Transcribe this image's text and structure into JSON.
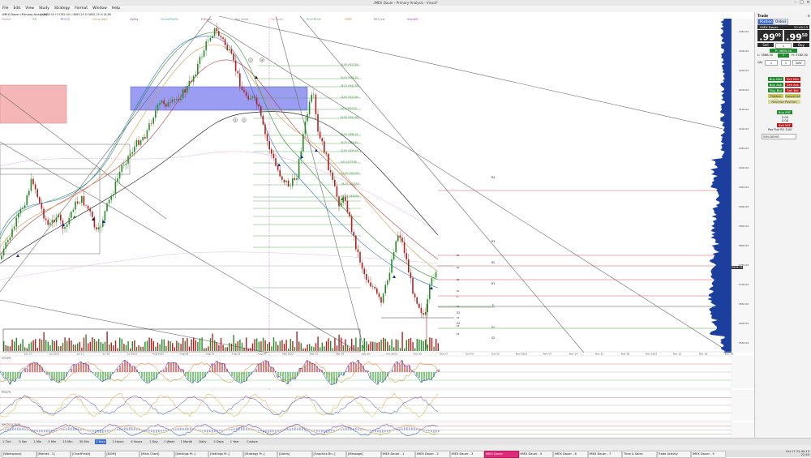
{
  "window": {
    "title": ".IMEX Dauer - Primary Analysis - Visual*",
    "controls": [
      "–",
      "□",
      "✕"
    ]
  },
  "menu": [
    "File",
    "Edit",
    "View",
    "Study",
    "Strategy",
    "Format",
    "Window",
    "Help"
  ],
  "chart": {
    "symbol_header": ".IMEX Dauer (Primary Analysis)",
    "ohlc_text": "L:3588.50 H:3782.00 L:3685.25 D:3695.25 V:14.88",
    "study_labels": [
      "Volume",
      "RSI",
      "MFI(14)",
      "Swing Highs",
      "ZigZag",
      "Volume Profile",
      "Bollinger",
      "Key Levels",
      "Fib Levels",
      "Pivot Points",
      "VWAP",
      "MA Cross",
      "Highlight"
    ],
    "x_dates": [
      "Jun 27",
      "Jul 2022",
      "Jul 11",
      "Jul 18",
      "Jul 2022",
      "Aug 2022",
      "Aug 08",
      "Aug 15",
      "Aug 22",
      "Aug 29",
      "Sep 2022",
      "Sep 12",
      "Sep 19",
      "Sep 26",
      "Oct 2022",
      "Oct 10",
      "Oct 17",
      "Oct 24",
      "Oct 31",
      "Nov 2022",
      "Nov 07",
      "Nov 14",
      "Nov 21",
      "Nov 28",
      "Dec 2022",
      "Dec 12",
      "Dec 19",
      "Dec 26"
    ],
    "right_prices": [
      "4350.00",
      "4300.00",
      "4250.00",
      "4200.00",
      "4150.00",
      "4100.00",
      "4050.00",
      "4000.00",
      "3950.00",
      "3900.00",
      "3850.00",
      "3800.00",
      "3750.00",
      "3700.00",
      "3650.00",
      "3600.00",
      "3550.00"
    ],
    "current_price": "3695.25",
    "pivot_labels": [
      "R4",
      "R3",
      "R2",
      "R1",
      "P",
      "S1",
      "S2",
      "S3",
      "S4"
    ],
    "wave_labels": [
      "2",
      "4",
      "3",
      "1"
    ],
    "fib_labels": [
      "61.8% (4317.89)",
      "50.0% (4195.25)",
      "38.2% (4162.78)",
      "23.6% (4123.38)",
      "0.0% (4053.25)",
      "61.8% (3932.38)",
      "50.0% (3896.10)",
      "38.2% (3859.81)",
      "23.6% (3814.93)",
      "0.0% (3774.00)",
      "-23.6% (3702.94)",
      "-38.2% (3659.00)",
      "-61.8% (3588.06)"
    ],
    "indicator_titles": [
      "CCI(14)",
      "RSI(14)",
      "MACD(12,26,9)"
    ]
  },
  "tradepanel": {
    "title": "Trade",
    "tabs": [
      "Position",
      "Orders"
    ],
    "symbol": ".IMEX Dauer",
    "time": "22:40:13",
    "bid_big": ".99",
    "bid_sup": "00",
    "ask_big": ".99",
    "ask_sup": "50",
    "sell_label": "Sell",
    "buy_label": "Buy",
    "qty": "1",
    "position_text": "P: 3695.50",
    "range_text": "L: 3588.50",
    "range_hi": "H: 3782.00",
    "qty_label": "Qty",
    "tif": "DAY",
    "btns": {
      "buy_mkt": "Buy Mkt",
      "sell_mkt": "Sell Mkt",
      "buy_ask": "Buy Ask",
      "sell_ask": "Sell Ask",
      "buy_bid": "Buy Bid",
      "sell_bid": "Sell Bid",
      "flatten": "Flatten All",
      "cancel": "Cancel All",
      "reverse": "Reverse Position",
      "buy_mit": "Buy MIT",
      "sell_mit": "Sell MIT"
    },
    "offset_val": "0.00",
    "offset_val2": "0.00",
    "pos_line": "Pos  Flat  P/L  0.00",
    "account": "SIM-DEMO"
  },
  "timeframes": [
    "1 Tick",
    "5 Sec",
    "1 Min",
    "5 Min",
    "15 Min",
    "30 Min",
    "1 Hour",
    "2 Hours",
    "4 Hours",
    "1 Day",
    "1 Week",
    "1 Month",
    "Daily",
    "2 Days",
    "1 Year",
    "Custom"
  ],
  "taskbar": [
    "[Workspace]",
    "[Market - 1]",
    "[ChartFresh]",
    "[DOM]",
    "[Main Chart]",
    "[Settings Pr..]",
    "[Settings Pr..]",
    "[Strategy Pr..]",
    "[Alerts]",
    "[Graphics Bn..]",
    "[Message]",
    "IMEX Dauer - 1",
    "IMEX Dauer - 2",
    "IMEX Dauer - 3",
    "IMEX Dauer",
    "IMEX Dauer - 5",
    "IMEX Dauer - 6",
    "IMEX Dauer - 7",
    "Time & Sales",
    "Trade Activity",
    "IMEX Dauer - 9"
  ],
  "active_window": "IMEX Dauer",
  "clock": {
    "date": "Oct 17 22:40:13",
    "extra": "22:40"
  },
  "colors": {
    "accent": "#3c6fc4",
    "active_window": "#e02b7a",
    "buy": "#1e8c2e",
    "sell": "#b81e1e",
    "profile": "#1c3f9e"
  }
}
